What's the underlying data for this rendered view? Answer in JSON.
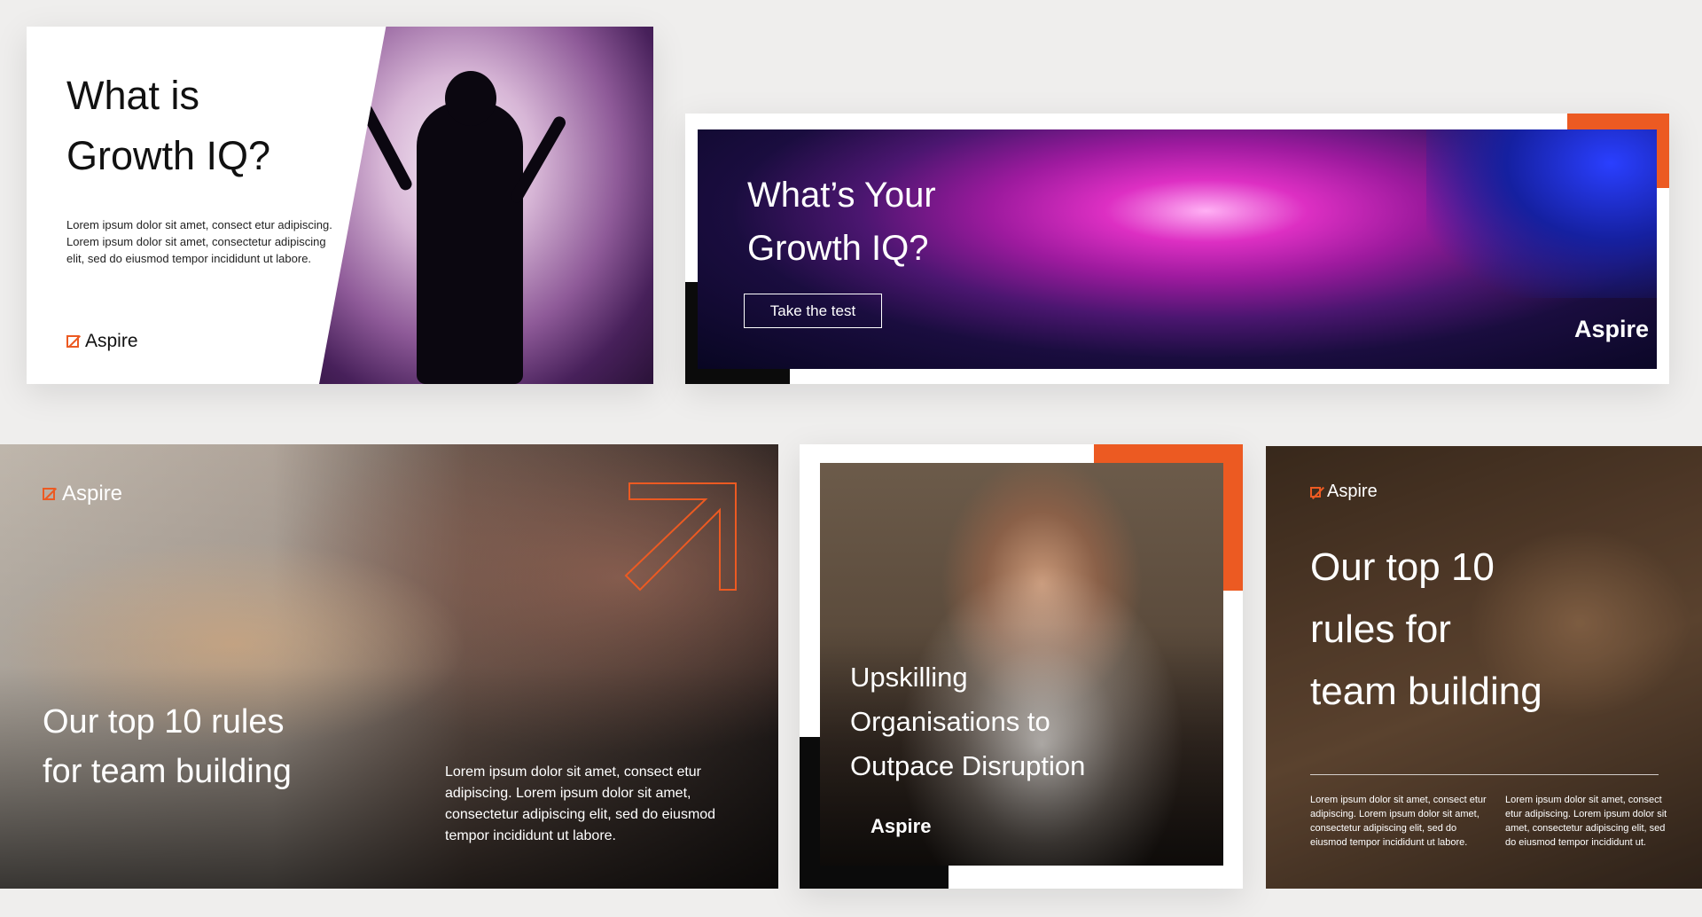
{
  "brand": {
    "name": "Aspire",
    "accent": "#ec5a22"
  },
  "card1": {
    "title_line1": "What is",
    "title_line2": "Growth IQ?",
    "body": "Lorem ipsum dolor sit amet, consect etur adipiscing. Lorem ipsum dolor sit amet, consectetur adipiscing elit, sed do eiusmod tempor incididunt ut labore.",
    "logo": "Aspire"
  },
  "card2": {
    "title_line1": "What’s Your",
    "title_line2": "Growth IQ?",
    "button_label": "Take the test",
    "logo": "Aspire"
  },
  "card3": {
    "logo": "Aspire",
    "title_line1": "Our top 10 rules",
    "title_line2": "for team building",
    "body": "Lorem ipsum dolor sit amet, consect etur adipiscing. Lorem ipsum dolor sit amet, consectetur adipiscing elit, sed do eiusmod tempor incididunt ut labore."
  },
  "card4": {
    "title_line1": "Upskilling",
    "title_line2": "Organisations to",
    "title_line3": "Outpace Disruption",
    "logo": "Aspire"
  },
  "card5": {
    "logo": "Aspire",
    "title_line1": "Our top 10",
    "title_line2": "rules for",
    "title_line3": "team building",
    "body_left": "Lorem ipsum dolor sit amet, consect etur adipiscing. Lorem ipsum dolor sit amet, consectetur adipiscing elit, sed do eiusmod tempor incididunt ut labore.",
    "body_right": "Lorem ipsum dolor sit amet, consect etur adipiscing. Lorem ipsum dolor sit amet, consectetur adipiscing elit, sed do eiusmod tempor incididunt ut."
  }
}
